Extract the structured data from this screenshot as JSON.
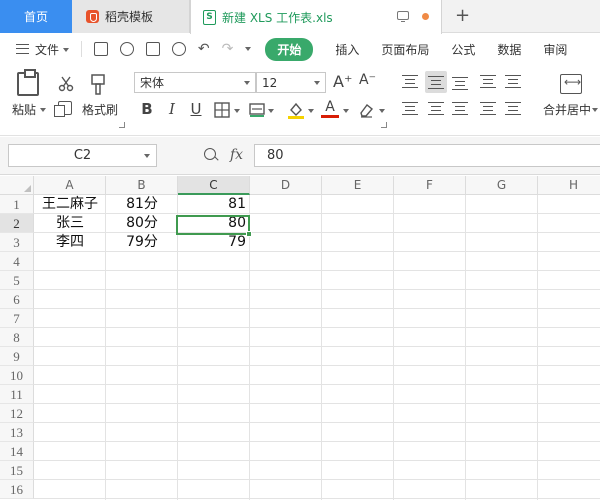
{
  "tabs": {
    "home": "首页",
    "template": "稻壳模板",
    "document": "新建 XLS 工作表.xls",
    "doc_icon": "S"
  },
  "menu": {
    "file": "文件",
    "active": "开始",
    "items": [
      "插入",
      "页面布局",
      "公式",
      "数据",
      "审阅"
    ]
  },
  "ribbon": {
    "paste": "粘贴",
    "format_painter": "格式刷",
    "font_name": "宋体",
    "font_size": "12",
    "bold": "B",
    "italic": "I",
    "underline": "U",
    "font_color_glyph": "A",
    "grow_font": "A⁺",
    "shrink_font": "A⁻",
    "merge_center": "合并居中"
  },
  "formula_bar": {
    "cell_ref": "C2",
    "fx": "fx",
    "value": "80"
  },
  "sheet": {
    "columns": [
      "A",
      "B",
      "C",
      "D",
      "E",
      "F",
      "G",
      "H"
    ],
    "rows": [
      "1",
      "2",
      "3",
      "4",
      "5",
      "6",
      "7",
      "8",
      "9",
      "10",
      "11",
      "12",
      "13",
      "14",
      "15",
      "16"
    ],
    "data": [
      [
        "王二麻子",
        "81分",
        "81"
      ],
      [
        "张三",
        "80分",
        "80"
      ],
      [
        "李四",
        "79分",
        "79"
      ]
    ],
    "active_cell": "C2"
  },
  "icons": {
    "menu": "hamburger-icon",
    "new_tab": "plus-icon",
    "save": "save-icon",
    "print": "print-icon",
    "undo": "undo-icon",
    "redo": "redo-icon"
  },
  "colors": {
    "accent_green": "#39a96b",
    "home_blue": "#3a8ef0",
    "selection": "#3f9a4f"
  }
}
